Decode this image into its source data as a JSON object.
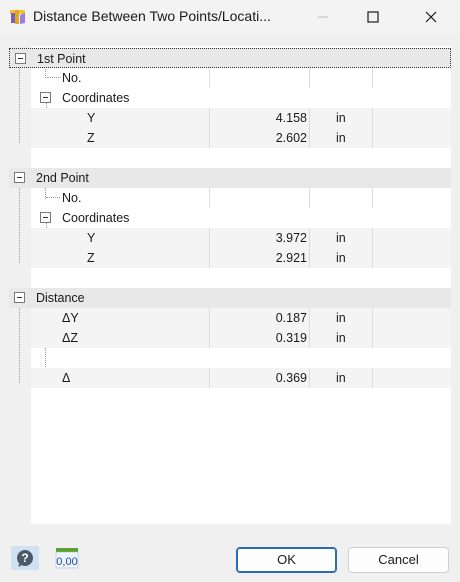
{
  "window": {
    "title": "Distance Between Two Points/Locati...",
    "app_icon": "rfem-section-icon",
    "controls": [
      "minimize-icon",
      "maximize-icon",
      "close-icon"
    ]
  },
  "tree": {
    "point1": {
      "label": "1st Point",
      "no_label": "No.",
      "no_value": "",
      "coords_label": "Coordinates",
      "y_label": "Y",
      "y_value": "4.158",
      "y_unit": "in",
      "z_label": "Z",
      "z_value": "2.602",
      "z_unit": "in"
    },
    "point2": {
      "label": "2nd Point",
      "no_label": "No.",
      "no_value": "",
      "coords_label": "Coordinates",
      "y_label": "Y",
      "y_value": "3.972",
      "y_unit": "in",
      "z_label": "Z",
      "z_value": "2.921",
      "z_unit": "in"
    },
    "distance": {
      "label": "Distance",
      "dy_label": "ΔY",
      "dy_value": "0.187",
      "dy_unit": "in",
      "dz_label": "ΔZ",
      "dz_value": "0.319",
      "dz_unit": "in",
      "d_label": "Δ",
      "d_value": "0.369",
      "d_unit": "in"
    }
  },
  "footer": {
    "help_icon": "help-icon",
    "units_icon": "units-decimal-icon",
    "units_text": "0,00",
    "ok_label": "OK",
    "cancel_label": "Cancel"
  }
}
